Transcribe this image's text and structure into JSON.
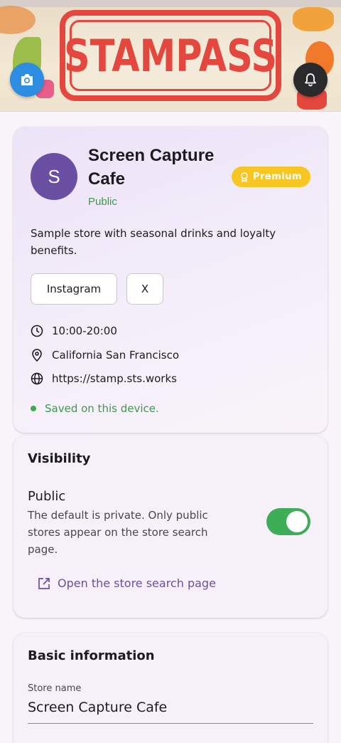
{
  "banner": {
    "logo_text": "STAMPASS"
  },
  "store": {
    "avatar_letter": "S",
    "name": "Screen Capture Cafe",
    "badge": "Premium",
    "status": "Public",
    "description": "Sample store with seasonal drinks and loyalty benefits.",
    "links": [
      {
        "label": "Instagram"
      },
      {
        "label": "X"
      }
    ],
    "hours": "10:00-20:00",
    "location": "California San Francisco",
    "website": "https://stamp.sts.works",
    "saved_text": "Saved on this device."
  },
  "visibility": {
    "title": "Visibility",
    "label": "Public",
    "help": "The default is private. Only public stores appear on the store search page.",
    "enabled": true,
    "link_label": "Open the store search page"
  },
  "basic_info": {
    "title": "Basic information",
    "store_name_label": "Store name",
    "store_name_value": "Screen Capture Cafe"
  },
  "colors": {
    "accent": "#6a4fa3",
    "success": "#3d9a4b",
    "premium": "#f8c623",
    "stamp_red": "#e4473d"
  }
}
